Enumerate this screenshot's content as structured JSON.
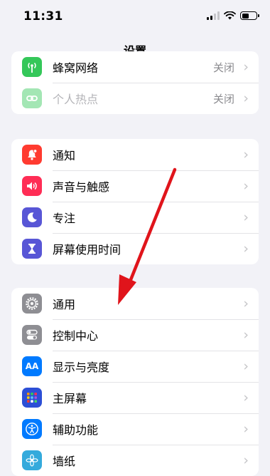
{
  "status_bar": {
    "time": "11:31"
  },
  "nav": {
    "title": "设置"
  },
  "group1": {
    "rows": [
      {
        "label": "蜂窝网络",
        "value": "关闭",
        "icon": "antenna-icon",
        "color": "#34c759"
      },
      {
        "label": "个人热点",
        "value": "关闭",
        "icon": "chain-link-icon",
        "color": "#34c759",
        "disabled": true
      }
    ]
  },
  "group2": {
    "rows": [
      {
        "label": "通知",
        "icon": "bell-icon",
        "color": "#ff3b30"
      },
      {
        "label": "声音与触感",
        "icon": "speaker-icon",
        "color": "#ff2d55"
      },
      {
        "label": "专注",
        "icon": "moon-icon",
        "color": "#5856d6"
      },
      {
        "label": "屏幕使用时间",
        "icon": "hourglass-icon",
        "color": "#5856d6"
      }
    ]
  },
  "group3": {
    "rows": [
      {
        "label": "通用",
        "icon": "gear-icon",
        "color": "#8e8e93"
      },
      {
        "label": "控制中心",
        "icon": "toggles-icon",
        "color": "#8e8e93"
      },
      {
        "label": "显示与亮度",
        "icon": "aa-text-icon",
        "icon_text": "AA",
        "color": "#007aff"
      },
      {
        "label": "主屏幕",
        "icon": "app-grid-icon",
        "color": "#2c4fd6"
      },
      {
        "label": "辅助功能",
        "icon": "accessibility-icon",
        "color": "#007aff"
      },
      {
        "label": "墙纸",
        "icon": "flower-icon",
        "color": "#34aadc"
      }
    ]
  },
  "annotation": {
    "color": "#e0141b"
  }
}
